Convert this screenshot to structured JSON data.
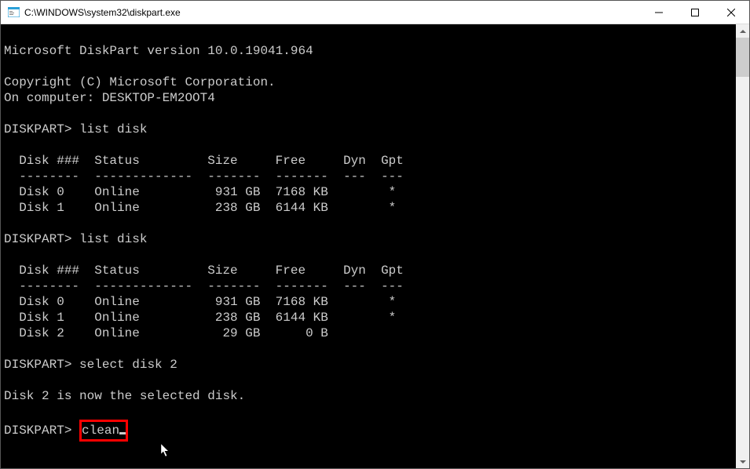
{
  "window": {
    "title": "C:\\WINDOWS\\system32\\diskpart.exe"
  },
  "terminal": {
    "version_line": "Microsoft DiskPart version 10.0.19041.964",
    "copyright_line": "Copyright (C) Microsoft Corporation.",
    "computer_line": "On computer: DESKTOP-EM2OOT4",
    "prompt": "DISKPART>",
    "cmd_list_disk": "list disk",
    "header": "  Disk ###  Status         Size     Free     Dyn  Gpt",
    "divider": "  --------  -------------  -------  -------  ---  ---",
    "table1_rows": [
      "  Disk 0    Online          931 GB  7168 KB        *",
      "  Disk 1    Online          238 GB  6144 KB        *"
    ],
    "table2_rows": [
      "  Disk 0    Online          931 GB  7168 KB        *",
      "  Disk 1    Online          238 GB  6144 KB        *",
      "  Disk 2    Online           29 GB      0 B"
    ],
    "cmd_select": "select disk 2",
    "select_result": "Disk 2 is now the selected disk.",
    "cmd_clean": "clean"
  }
}
